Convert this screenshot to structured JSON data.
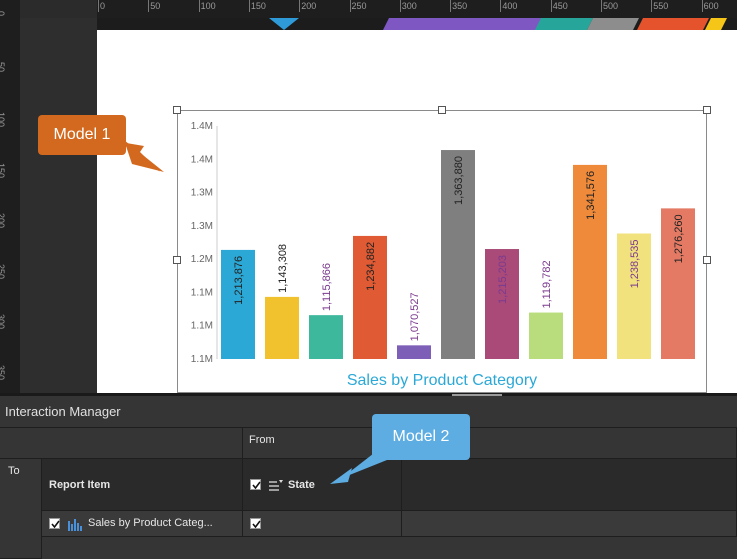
{
  "ruler_top_ticks": [
    "0",
    "50",
    "100",
    "150",
    "200",
    "250",
    "300",
    "350",
    "400",
    "450",
    "500",
    "550",
    "600"
  ],
  "ruler_left_ticks": [
    "0",
    "50",
    "100",
    "150",
    "200",
    "250",
    "300",
    "350"
  ],
  "colors": {
    "band": [
      "#2e9bd8",
      "#7e57c2",
      "#7e57c2",
      "#26a69a",
      "#8d8d8d",
      "#e5532c",
      "#f5c518"
    ]
  },
  "callout1": "Model 1",
  "callout2": "Model 2",
  "chart_data": {
    "type": "bar",
    "title": "Sales by Product Category",
    "categories": [
      "",
      "",
      "",
      "",
      "",
      "",
      "",
      "",
      "",
      "",
      "",
      ""
    ],
    "values": [
      1213876,
      1143308,
      1115866,
      1234882,
      1070527,
      1363880,
      1215203,
      1119782,
      1341576,
      1238535,
      1276260
    ],
    "data_labels": [
      "1,213,876",
      "1,143,308",
      "1,115,866",
      "1,234,882",
      "1,070,527",
      "1,363,880",
      "1,215,203",
      "1,119,782",
      "1,341,576",
      "1,238,535",
      "1,276,260"
    ],
    "colors": [
      "#2ba8d6",
      "#f2c12e",
      "#3db89c",
      "#e05a34",
      "#7e5fb8",
      "#7f7f7f",
      "#a94a78",
      "#b9dd7d",
      "#ef8a3a",
      "#f2e27e",
      "#e47a64"
    ],
    "label_colors": [
      "#222222",
      "#222222",
      "#7b3a8f",
      "#222222",
      "#7b3a8f",
      "#222222",
      "#7b3a8f",
      "#7b3a8f",
      "#222222",
      "#7b3a8f",
      "#222222"
    ],
    "y_tick_labels": [
      "1.4M",
      "1.4M",
      "1.3M",
      "1.3M",
      "1.2M",
      "1.1M",
      "1.1M",
      "1.1M"
    ],
    "ylim": [
      1050000,
      1400000
    ],
    "grid": false,
    "legend": "none"
  },
  "interaction_manager": {
    "title": "Interaction Manager",
    "from_label": "From",
    "to_label": "To",
    "report_item_label": "Report Item",
    "state_label": "State",
    "row_item_label": "Sales by Product Categ..."
  }
}
